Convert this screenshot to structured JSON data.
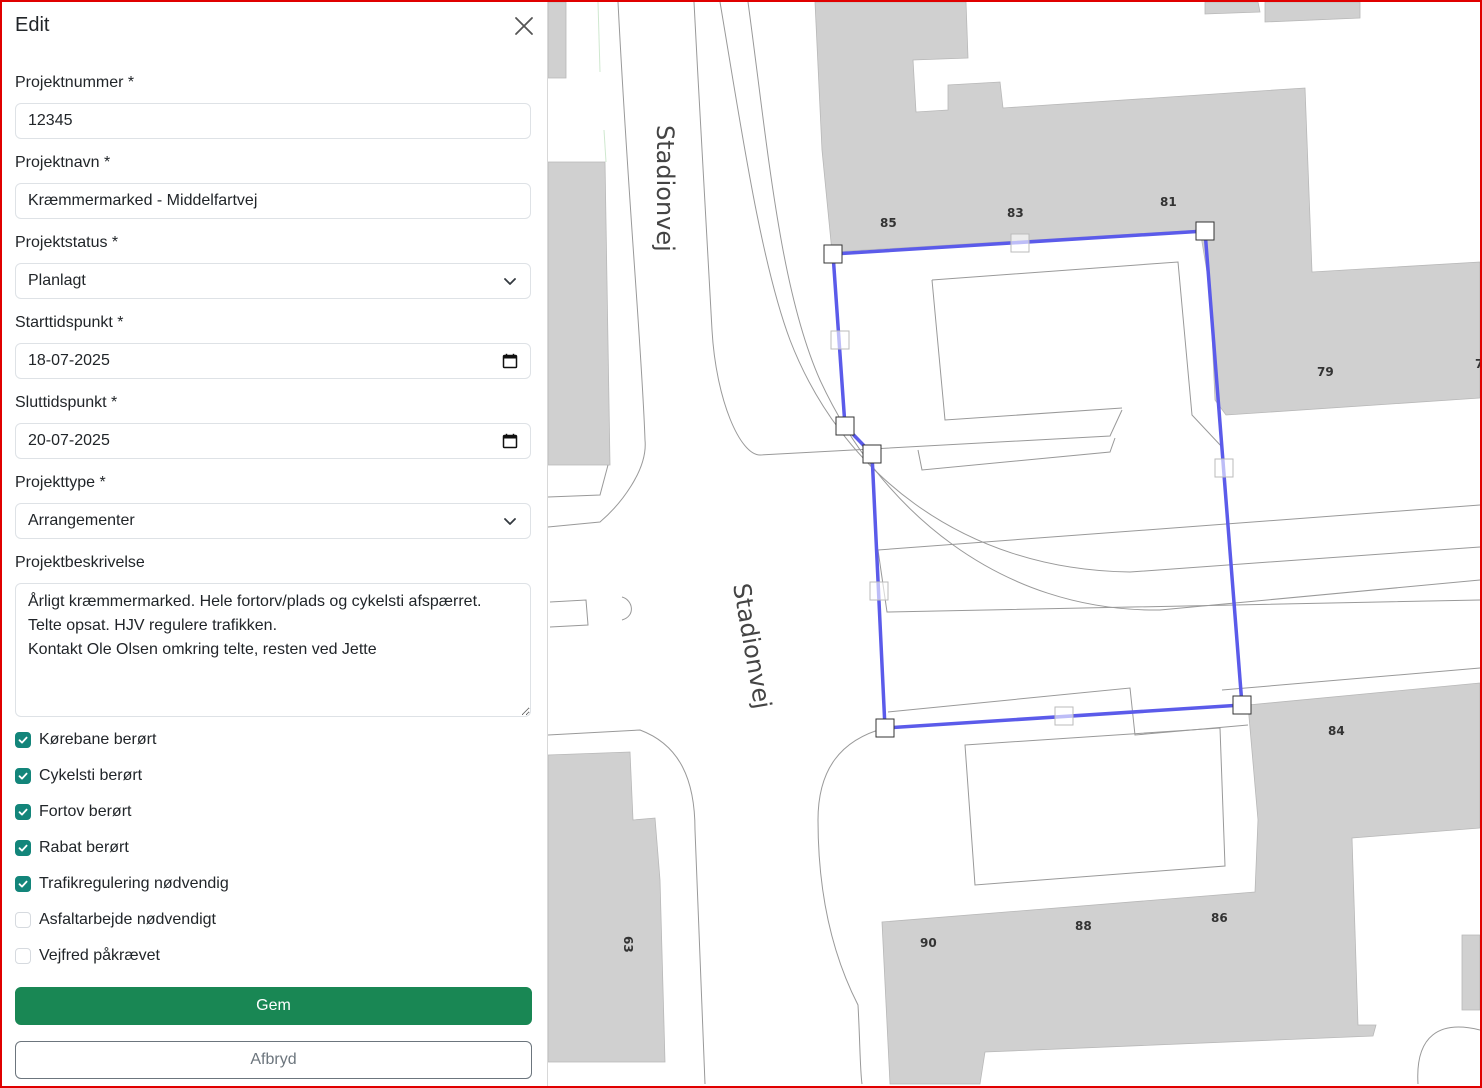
{
  "panel": {
    "title": "Edit",
    "fields": {
      "projektnummer": {
        "label": "Projektnummer *",
        "value": "12345"
      },
      "projektnavn": {
        "label": "Projektnavn *",
        "value": "Kræmmermarked - Middelfartvej"
      },
      "projektstatus": {
        "label": "Projektstatus *",
        "value": "Planlagt"
      },
      "starttidspunkt": {
        "label": "Starttidspunkt *",
        "value": "18-07-2025"
      },
      "sluttidspunkt": {
        "label": "Sluttidspunkt *",
        "value": "20-07-2025"
      },
      "projekttype": {
        "label": "Projekttype *",
        "value": "Arrangementer"
      },
      "projektbeskrivelse": {
        "label": "Projektbeskrivelse",
        "value": "Årligt kræmmermarked. Hele fortorv/plads og cykelsti afspærret.\nTelte opsat. HJV regulere trafikken.\nKontakt Ole Olsen omkring telte, resten ved Jette"
      }
    },
    "checkboxes": [
      {
        "label": "Kørebane berørt",
        "checked": true
      },
      {
        "label": "Cykelsti berørt",
        "checked": true
      },
      {
        "label": "Fortov berørt",
        "checked": true
      },
      {
        "label": "Rabat berørt",
        "checked": true
      },
      {
        "label": "Trafikregulering nødvendig",
        "checked": true
      },
      {
        "label": "Asfaltarbejde nødvendigt",
        "checked": false
      },
      {
        "label": "Vejfred påkrævet",
        "checked": false
      }
    ],
    "buttons": {
      "save": "Gem",
      "cancel": "Afbryd"
    }
  },
  "map": {
    "street_labels": [
      "Stadionvej",
      "Stadionvej"
    ],
    "house_numbers": [
      "85",
      "83",
      "81",
      "79",
      "84",
      "88",
      "86",
      "90",
      "63",
      "7"
    ],
    "colors": {
      "building": "#d0d0d0",
      "polygon": "#5b5bea",
      "street_line": "#999999"
    }
  },
  "colors": {
    "primary": "#198754",
    "checkbox": "#13857a",
    "frame": "#e00000"
  }
}
